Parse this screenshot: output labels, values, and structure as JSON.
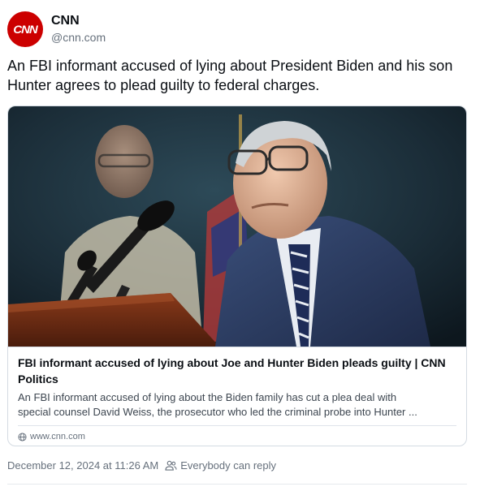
{
  "author": {
    "display_name": "CNN",
    "handle": "@cnn.com",
    "avatar_text": "CNN",
    "avatar_color": "#cc0000"
  },
  "post": {
    "text": "An FBI informant accused of lying about President Biden and his son Hunter agrees to plead guilty to federal charges."
  },
  "link_card": {
    "title": "FBI informant accused of lying about Joe and Hunter Biden pleads guilty | CNN Politics",
    "description_line1": "An FBI informant accused of lying about the Biden family has cut a plea deal with",
    "description_line2": "special counsel David Weiss, the prosecutor who led the criminal probe into Hunter ...",
    "domain": "www.cnn.com"
  },
  "meta": {
    "timestamp": "December 12, 2024 at 11:26 AM",
    "reply_setting": "Everybody can reply"
  },
  "colors": {
    "muted_text": "#66707c",
    "border": "#d4dbe2"
  }
}
